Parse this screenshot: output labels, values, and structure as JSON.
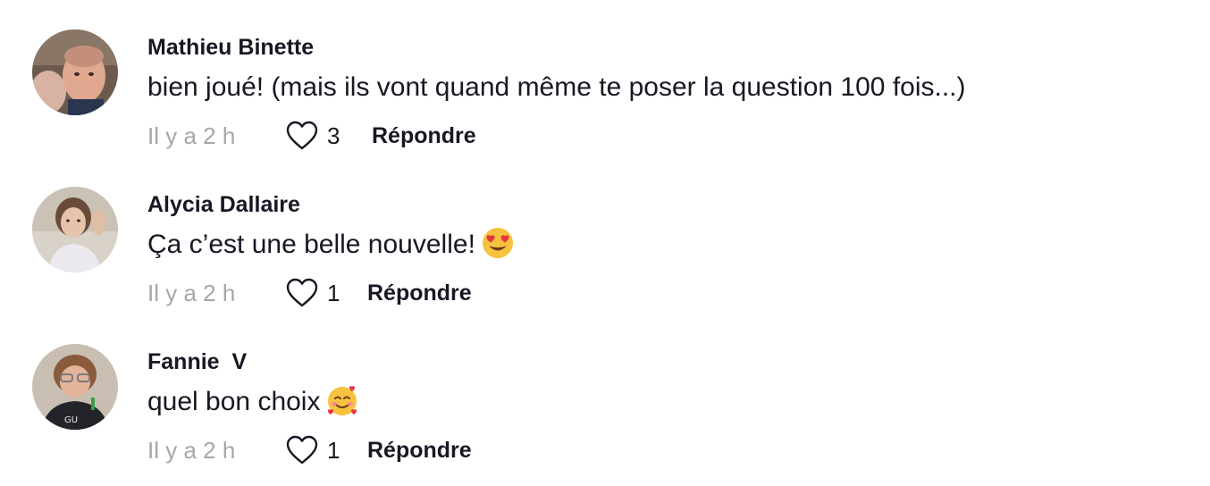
{
  "comments": [
    {
      "username": "Mathieu Binette",
      "text": "bien joué! (mais ils vont quand même te poser la question 100 fois...)",
      "emoji": "",
      "time": "Il y a 2 h",
      "likes": "3",
      "reply_label": "Répondre",
      "avatar_icon": "avatar-photo-man"
    },
    {
      "username": "Alycia Dallaire",
      "text": "Ça c’est une belle nouvelle!",
      "emoji": "heart-eyes-emoji",
      "time": "Il y a 2 h",
      "likes": "1",
      "reply_label": "Répondre",
      "avatar_icon": "avatar-photo-woman"
    },
    {
      "username": "Fannie  V",
      "text": "quel bon choix",
      "emoji": "smiling-face-with-hearts-emoji",
      "time": "Il y a 2 h",
      "likes": "1",
      "reply_label": "Répondre",
      "avatar_icon": "avatar-photo-woman-glasses"
    }
  ],
  "icons": {
    "like": "heart-outline-icon"
  },
  "colors": {
    "text": "#161823",
    "muted": "#a6a7ab",
    "background": "#ffffff"
  }
}
